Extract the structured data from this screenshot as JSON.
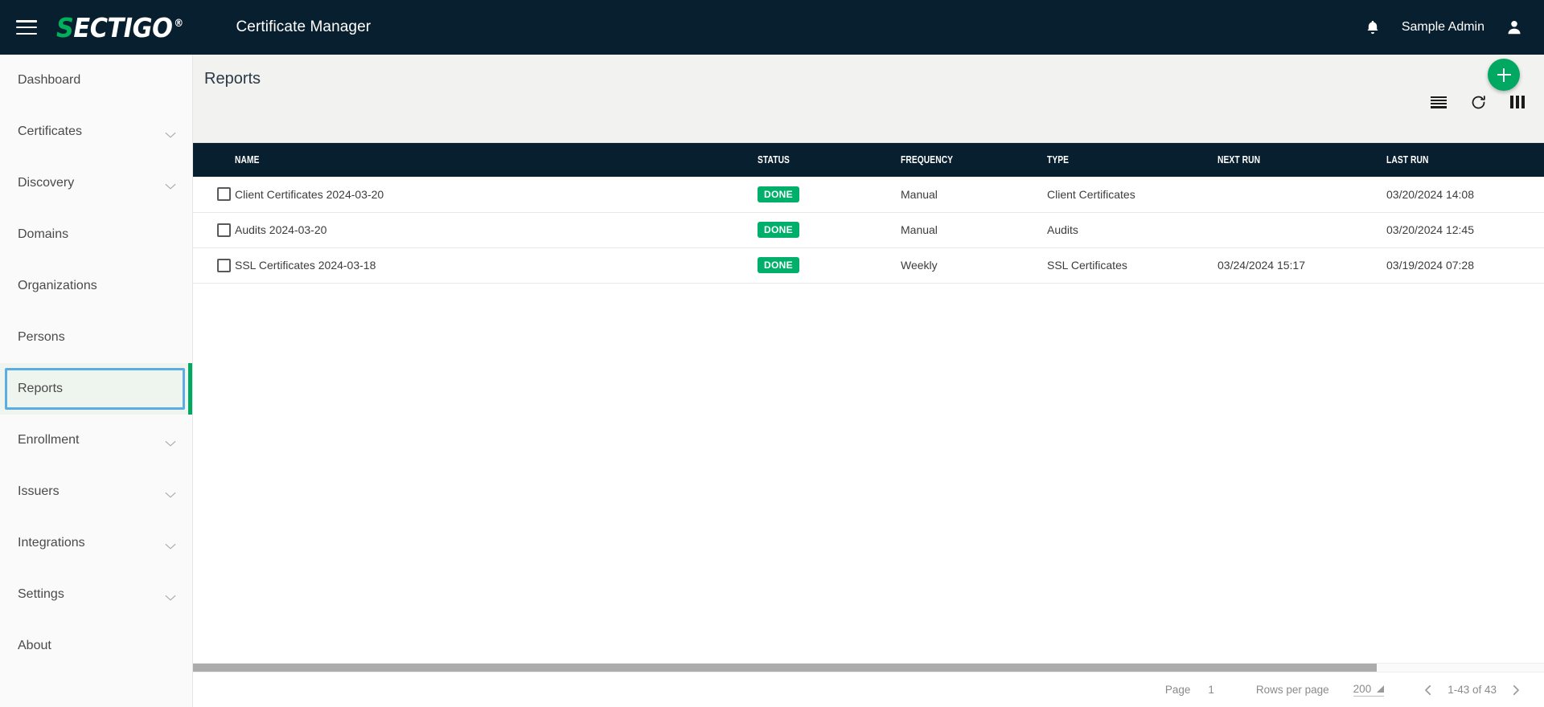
{
  "navbar": {
    "menu_icon": "hamburger-icon",
    "logo_first": "S",
    "logo_rest": "ECTIGO",
    "logo_reg": "®",
    "app_title": "Certificate Manager",
    "notifications_icon": "bell-icon",
    "user_name": "Sample Admin",
    "avatar_icon": "user-icon"
  },
  "sidebar": {
    "items": [
      {
        "label": "Dashboard",
        "expandable": false,
        "active": false
      },
      {
        "label": "Certificates",
        "expandable": true,
        "active": false
      },
      {
        "label": "Discovery",
        "expandable": true,
        "active": false
      },
      {
        "label": "Domains",
        "expandable": false,
        "active": false
      },
      {
        "label": "Organizations",
        "expandable": false,
        "active": false
      },
      {
        "label": "Persons",
        "expandable": false,
        "active": false
      },
      {
        "label": "Reports",
        "expandable": false,
        "active": true
      },
      {
        "label": "Enrollment",
        "expandable": true,
        "active": false
      },
      {
        "label": "Issuers",
        "expandable": true,
        "active": false
      },
      {
        "label": "Integrations",
        "expandable": true,
        "active": false
      },
      {
        "label": "Settings",
        "expandable": true,
        "active": false
      },
      {
        "label": "About",
        "expandable": false,
        "active": false
      }
    ],
    "active_accent_color": "#00a862",
    "focus_ring_color": "#5cabe2",
    "active_bg_color": "#eef5ef"
  },
  "page": {
    "title": "Reports",
    "add_button_label": "+",
    "add_button_color": "#00a862",
    "toolbar": [
      {
        "icon": "list-lines-icon"
      },
      {
        "icon": "refresh-icon"
      },
      {
        "icon": "columns-icon"
      }
    ]
  },
  "table": {
    "columns": [
      "NAME",
      "STATUS",
      "FREQUENCY",
      "TYPE",
      "NEXT RUN",
      "LAST RUN"
    ],
    "rows": [
      {
        "checked": false,
        "name": "Client Certificates 2024-03-20",
        "status": "DONE",
        "frequency": "Manual",
        "type": "Client Certificates",
        "next_run": "",
        "last_run": "03/20/2024 14:08"
      },
      {
        "checked": false,
        "name": "Audits 2024-03-20",
        "status": "DONE",
        "frequency": "Manual",
        "type": "Audits",
        "next_run": "",
        "last_run": "03/20/2024 12:45"
      },
      {
        "checked": false,
        "name": "SSL Certificates 2024-03-18",
        "status": "DONE",
        "frequency": "Weekly",
        "type": "SSL Certificates",
        "next_run": "03/24/2024 15:17",
        "last_run": "03/19/2024 07:28"
      }
    ],
    "status_color": "#00b06a"
  },
  "pagination": {
    "page_label": "Page",
    "page_value": "1",
    "rows_label": "Rows per page",
    "rows_value": "200",
    "prev_icon": "chevron-left-icon",
    "range": "1-43 of 43",
    "next_icon": "chevron-right-icon"
  }
}
